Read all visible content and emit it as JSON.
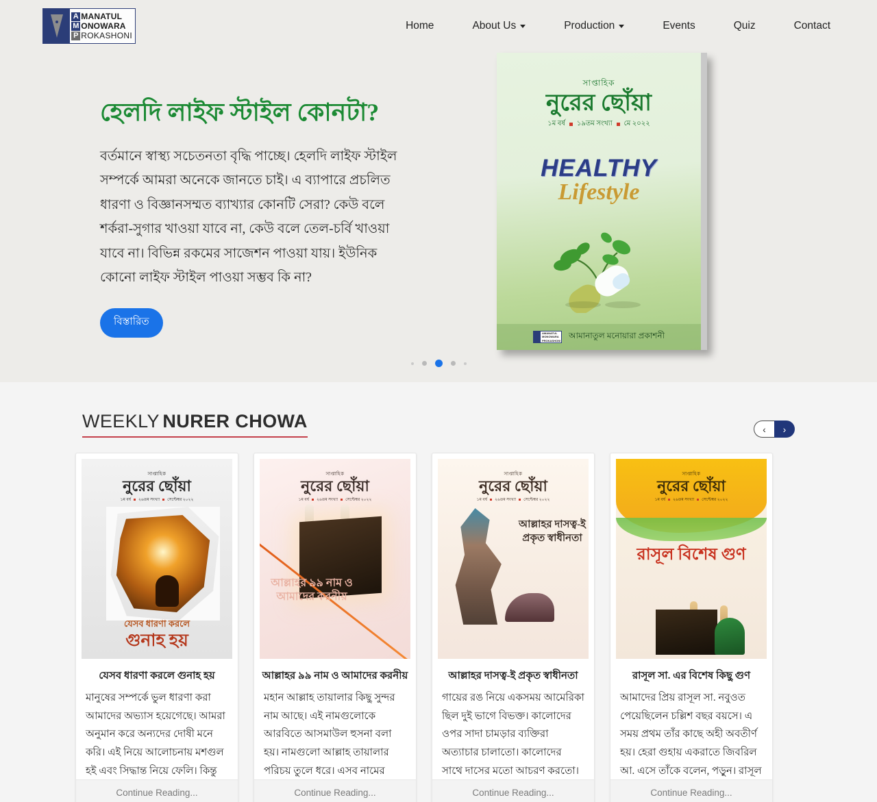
{
  "header": {
    "logo": {
      "line1_cap": "A",
      "line1_rest": "MANATUL",
      "line2_cap": "M",
      "line2_rest": "ONOWARA",
      "line3_cap": "P",
      "line3_rest": "ROKASHONI"
    },
    "nav": [
      {
        "label": "Home",
        "dropdown": false
      },
      {
        "label": "About Us",
        "dropdown": true
      },
      {
        "label": "Production",
        "dropdown": true
      },
      {
        "label": "Events",
        "dropdown": false
      },
      {
        "label": "Quiz",
        "dropdown": false
      },
      {
        "label": "Contact",
        "dropdown": false
      }
    ]
  },
  "hero": {
    "title": "হেলদি লাইফ স্টাইল কোনটা?",
    "body": "বর্তমানে স্বাস্থ্য সচেতনতা বৃদ্ধি পাচ্ছে। হেলদি লাইফ স্টাইল সম্পর্কে আমরা অনেকে জানতে চাই। এ ব্যাপারে প্রচলিত ধারণা ও বিজ্ঞানসম্মত ব্যাখ্যার কোনটি সেরা? কেউ বলে শর্করা-সুগার খাওয়া যাবে না, কেউ বলে তেল-চর্বি খাওয়া যাবে না। বিভিন্ন রকমের সাজেশন পাওয়া যায়। ইউনিক কোনো লাইফ স্টাইল পাওয়া সম্ভব কি না?",
    "button_label": "বিস্তারিত",
    "cover": {
      "weekly": "সাপ্তাহিক",
      "name": "নুরের ছোঁয়া",
      "issue_year": "১ম বর্ষ",
      "issue_number": "১৯তম সংখ্যা",
      "issue_date": "মে ২০২২",
      "headline_en": "HEALTHY",
      "subline_en": "Lifestyle",
      "publisher": "আমানাতুল মনোয়ারা প্রকাশনী"
    },
    "carousel": {
      "total_dots": 5,
      "active_index": 2
    },
    "accent_color": "#1a73e8",
    "title_color": "#1c8a34"
  },
  "weekly_section": {
    "title_light": "WEEKLY",
    "title_bold": "NURER CHOWA",
    "underline_color": "#c4404b",
    "prev_label": "‹",
    "next_label": "›",
    "continue_label": "Continue Reading...",
    "magazine": {
      "weekly": "সাপ্তাহিক",
      "name": "নুরের ছোঁয়া",
      "issue_year": "১ম বর্ষ",
      "issue_number": "২৬তম সংখ্যা",
      "issue_date": "সেপ্টেম্বর ২০২২"
    },
    "cards": [
      {
        "cover_title_small": "যেসব ধারণা করলে",
        "cover_title_big": "গুনাহ হয়",
        "title": "যেসব ধারণা করলে গুনাহ হয়",
        "body": "মানুষের সম্পর্কে ভুল ধারণা করা আমাদের অভ্যাস হয়েগেছে। আমরা অনুমান করে অন্যদের দোষী মনে করি। এই নিয়ে আলোচনায় মশগুল হই এবং সিদ্ধান্ত নিয়ে ফেলি। কিন্তু এর পরিণতি ভালো হয় না। এভাবে পরস্পরের সাথে"
      },
      {
        "cover_title_big": "আল্লাহর ৯৯ নাম ও আমাদের করনীয়",
        "title": "আল্লাহর ৯৯ নাম ও আমাদের করনীয়",
        "body": "মহান আল্লাহ তায়ালার কিছু সুন্দর নাম আছে। এই নামগুলোকে আরবিতে আসমাউল হুসনা বলা হয়। নামগুলো আল্লাহ তায়ালার পরিচয় তুলে ধরে। এসব নামের মাধ্যমে মানুষ আল্লাহর কথা ভালোভাবে জানতে পারে।"
      },
      {
        "cover_title_big": "আল্লাহর দাসত্ব-ই প্রকৃত স্বাধীনতা",
        "title": "আল্লাহর দাসত্ব-ই প্রকৃত স্বাধীনতা",
        "body": "গায়ের রঙ নিয়ে একসময় আমেরিকা ছিল দুই ভাগে বিভক্ত। কালোদের ওপর সাদা চামড়ার ব্যক্তিরা অত্যাচার চালাতো। কালোদের সাথে দাসের মতো আচরণ করতো। দাসত্ব থেকে বাঁচতে একসময় কৃষাঙ্গরা ব্যাপক"
      },
      {
        "cover_title_big": "রাসূল বিশেষ গুণ",
        "title": "রাসূল সা. এর বিশেষ কিছু গুণ",
        "body": "আমাদের প্রিয় রাসূল সা. নবুওত পেয়েছিলেন চল্লিশ বছর বয়সে। এ সময় প্রথম তাঁর কাছে অহী অবতীর্ণ হয়। হেরা গুহায় একরাতে জিবরিল আ. এসে তাঁকে বলেন, পড়ুন। রাসূল সা. যখন বললেন, আমি পড়তে জানি না।"
      }
    ]
  }
}
